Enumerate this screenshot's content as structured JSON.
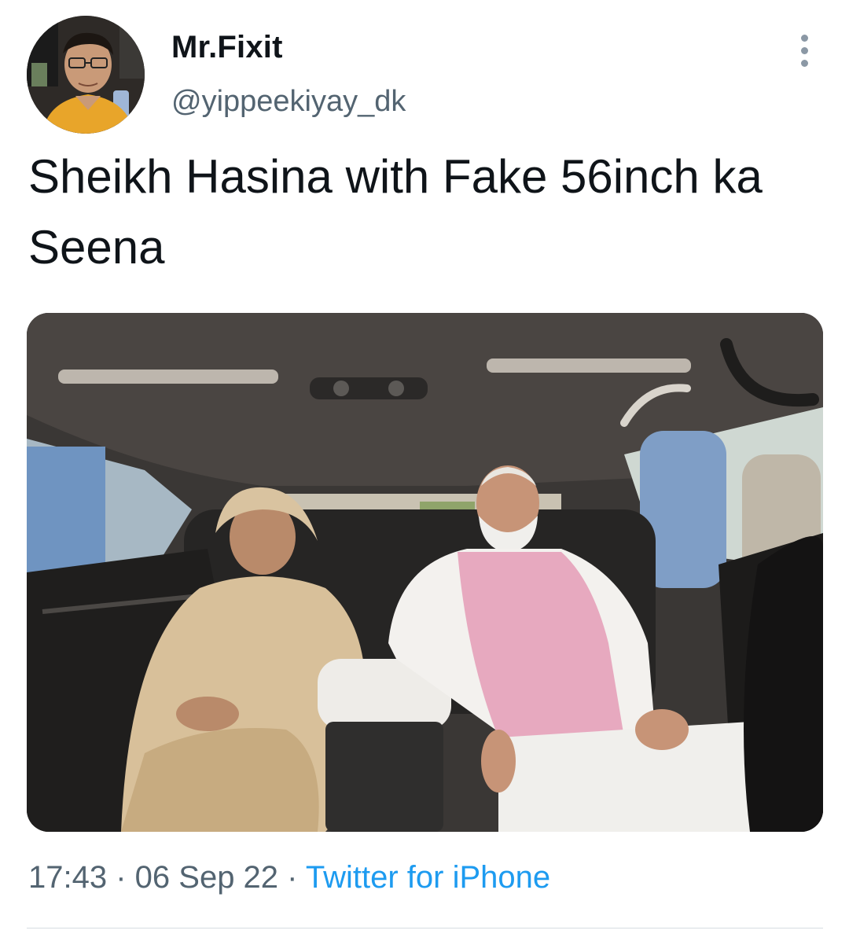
{
  "author": {
    "display_name": "Mr.Fixit",
    "handle": "@yippeekiyay_dk",
    "avatar_icon": "profile-photo"
  },
  "tweet": {
    "text": "Sheikh Hasina with Fake 56inch ka Seena",
    "media_icon": "photo-two-people-in-car-back-seat"
  },
  "meta": {
    "time": "17:43",
    "separator": " · ",
    "date": "06 Sep 22",
    "source": "Twitter for iPhone"
  },
  "menu": {
    "icon": "more-options-icon"
  },
  "colors": {
    "text_primary": "#0f1419",
    "text_secondary": "#536471",
    "link": "#1d9bf0",
    "divider": "#d6dde2"
  }
}
